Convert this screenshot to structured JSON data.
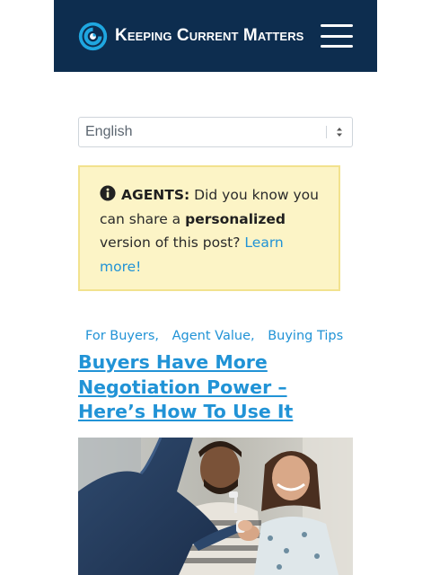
{
  "header": {
    "brand_name": "Keeping Current Matters",
    "logo_icon": "kcm-swirl-logo",
    "menu_icon": "hamburger-menu-icon",
    "background_color": "#0d2d4f"
  },
  "language_select": {
    "selected": "English",
    "options_icon": "select-arrows-icon"
  },
  "notice": {
    "icon": "info-circle-icon",
    "label": "AGENTS:",
    "text_before": "Did you know you can share a",
    "emphasis": "personalized",
    "text_after": "version of this post?",
    "link_text": "Learn more!",
    "background_color": "#fcf4c6",
    "border_color": "#f2e28e"
  },
  "post": {
    "categories": [
      {
        "label": "For Buyers"
      },
      {
        "label": "Agent Value"
      },
      {
        "label": "Buying Tips"
      }
    ],
    "title": "Buyers Have More Negotiation Power – Here’s How To Use It",
    "link_color": "#2193d6",
    "hero_image": "photo-agent-handing-keys-to-couple"
  }
}
